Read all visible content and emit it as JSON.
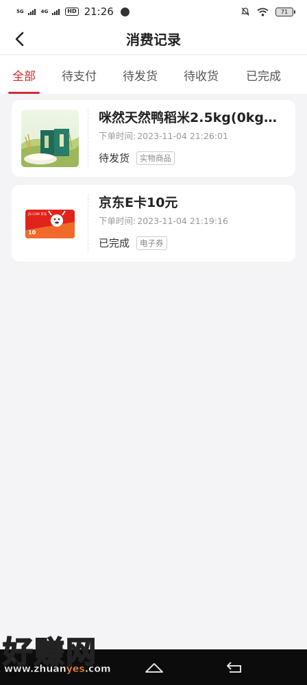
{
  "status_bar": {
    "net1": "5G",
    "net2": "4G",
    "hd": "HD",
    "time": "21:26",
    "battery": "71"
  },
  "header": {
    "title": "消费记录"
  },
  "tabs": [
    {
      "label": "全部",
      "active": true
    },
    {
      "label": "待支付",
      "active": false
    },
    {
      "label": "待发货",
      "active": false
    },
    {
      "label": "待收货",
      "active": false
    },
    {
      "label": "已完成",
      "active": false
    }
  ],
  "orders": [
    {
      "title": "咪然天然鸭稻米2.5kg(0kg…",
      "time_label": "下单时间:",
      "time": "2023-11-04 21:26:01",
      "status": "待发货",
      "tag": "实物商品",
      "thumb_icon": "rice-product-image"
    },
    {
      "title": "京东E卡10元",
      "time_label": "下单时间:",
      "time": "2023-11-04 21:19:16",
      "status": "已完成",
      "tag": "电子券",
      "thumb_icon": "jd-ecard-image",
      "card_value": "10",
      "card_brand": "JD.COM 京东"
    }
  ],
  "watermark": {
    "main": "好赚网",
    "url_pre": "www.zhuan",
    "url_mid": "yes",
    "url_post": ".com"
  },
  "colors": {
    "accent": "#d42a2a",
    "background": "#f4f4f7"
  }
}
